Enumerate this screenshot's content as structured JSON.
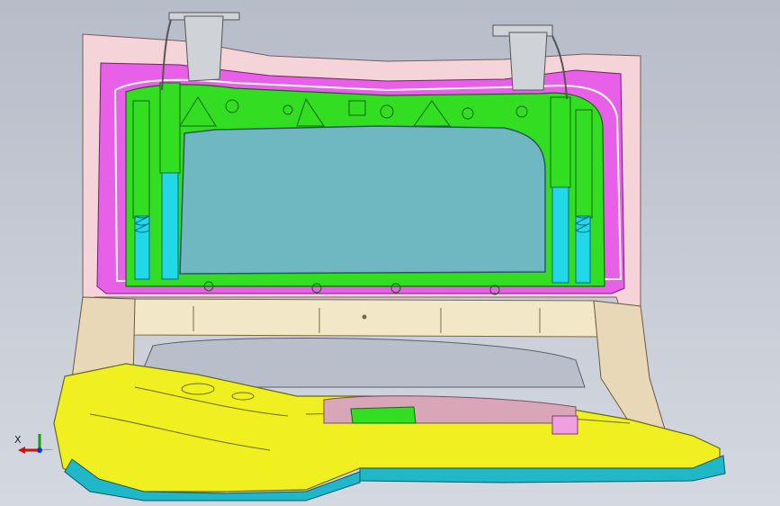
{
  "viewport": {
    "background_top": "#b6bcc8",
    "background_bottom": "#d4d8e0"
  },
  "triad": {
    "axis_label": "X",
    "x_color": "#d01010",
    "y_color": "#10a010",
    "z_color": "#1030d0"
  },
  "parts": {
    "outer_panel": "#f4d4d8",
    "magenta_inner": "#e860e8",
    "green_frame": "#33dd22",
    "glass": "#6fb8c2",
    "struts": "#22d8e8",
    "beige_rail": "#f2e8c8",
    "yellow_floor": "#f0f020",
    "cyan_edge": "#20b8c8",
    "hinge_grey": "#cfd2d6"
  }
}
